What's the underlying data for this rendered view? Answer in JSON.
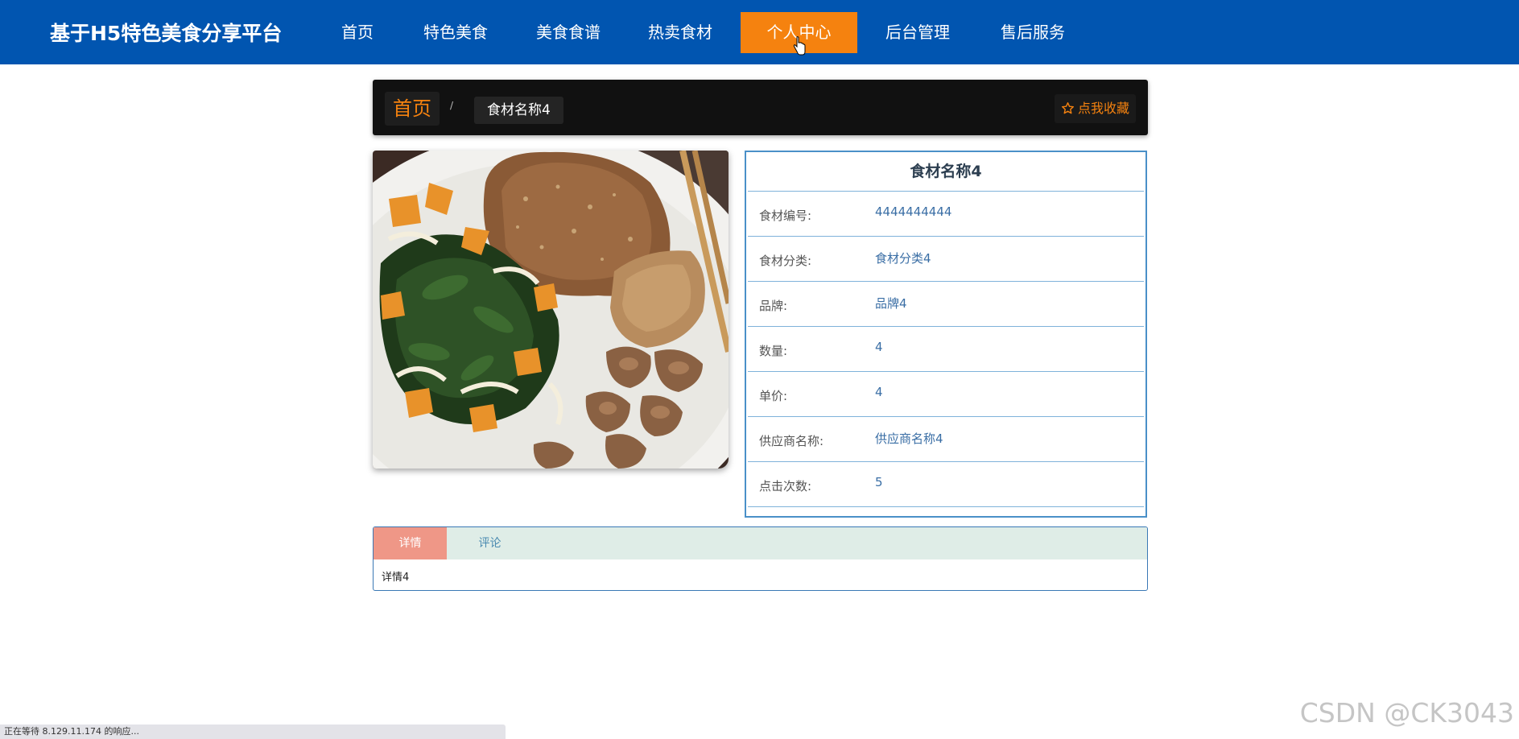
{
  "header": {
    "brand": "基于H5特色美食分享平台",
    "nav": [
      {
        "label": "首页",
        "active": false
      },
      {
        "label": "特色美食",
        "active": false
      },
      {
        "label": "美食食谱",
        "active": false
      },
      {
        "label": "热卖食材",
        "active": false
      },
      {
        "label": "个人中心",
        "active": true
      },
      {
        "label": "后台管理",
        "active": false
      },
      {
        "label": "售后服务",
        "active": false
      }
    ]
  },
  "breadcrumb": {
    "home": "首页",
    "separator": "/",
    "current": "食材名称4",
    "favorite_label": "点我收藏",
    "favorite_icon": "star-outline-icon"
  },
  "info": {
    "title": "食材名称4",
    "rows": [
      {
        "label": "食材编号:",
        "value": "4444444444"
      },
      {
        "label": "食材分类:",
        "value": "食材分类4"
      },
      {
        "label": "品牌:",
        "value": "品牌4"
      },
      {
        "label": "数量:",
        "value": "4"
      },
      {
        "label": "单价:",
        "value": "4"
      },
      {
        "label": "供应商名称:",
        "value": "供应商名称4"
      },
      {
        "label": "点击次数:",
        "value": "5"
      }
    ]
  },
  "tabs": {
    "items": [
      {
        "label": "详情",
        "active": true
      },
      {
        "label": "评论",
        "active": false
      }
    ],
    "content": "详情4"
  },
  "status_bar": {
    "text": "正在等待 8.129.11.174 的响应..."
  },
  "watermark": "CSDN @CK3043",
  "colors": {
    "header_bg": "#0155b0",
    "accent_orange": "#f5820f",
    "crumb_bg": "#111111",
    "info_border": "#4a90c8",
    "tab_active": "#ef9787",
    "tab_head_bg": "#dfede7"
  }
}
